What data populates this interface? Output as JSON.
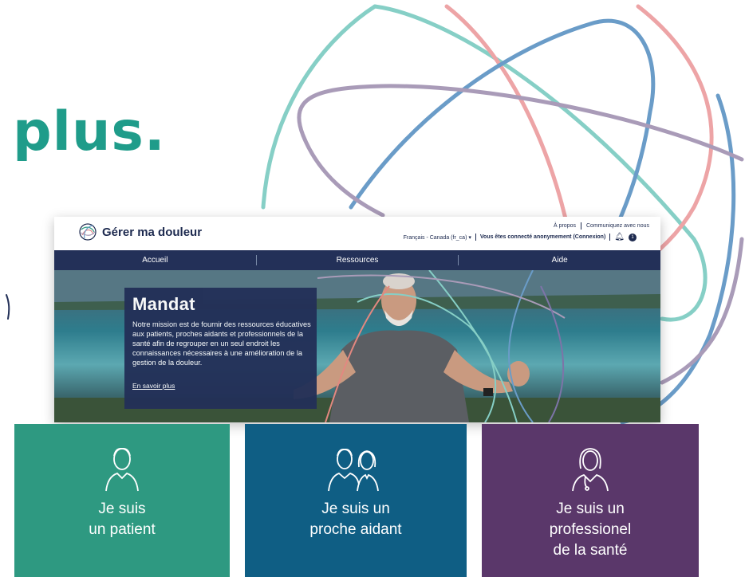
{
  "background": {
    "headline": "plus."
  },
  "site": {
    "logo_text": "Gérer ma douleur",
    "top_links": [
      "À propos",
      "Communiquez avec nous"
    ],
    "language": "Français - Canada (fr_ca)",
    "login_status": "Vous êtes connecté anonymement (Connexion)",
    "notification_count": "1",
    "nav": [
      "Accueil",
      "Ressources",
      "Aide"
    ]
  },
  "hero": {
    "title": "Mandat",
    "text": "Notre mission est de fournir des ressources éducatives aux patients, proches aidants et professionnels de la santé afin de regrouper en un seul endroit les connaissances nécessaires à une amélioration de la gestion de la douleur.",
    "link": "En savoir plus"
  },
  "tiles": [
    {
      "line1": "Je suis",
      "line2": "un patient",
      "line3": "",
      "icon": "patient-icon",
      "color": "#2e9981"
    },
    {
      "line1": "Je suis un",
      "line2": "proche aidant",
      "line3": "",
      "icon": "caregivers-icon",
      "color": "#0f5e84"
    },
    {
      "line1": "Je suis un",
      "line2": "professionel",
      "line3": "de la santé",
      "icon": "health-professional-icon",
      "color": "#5a376a"
    }
  ],
  "colors": {
    "accent": "#1f9c8a",
    "navy": "#233058",
    "teal_ring": "#86cfc6",
    "pink_ring": "#eda4a6",
    "blue_ring": "#6a9cc8",
    "purple_ring": "#a99bb8"
  }
}
